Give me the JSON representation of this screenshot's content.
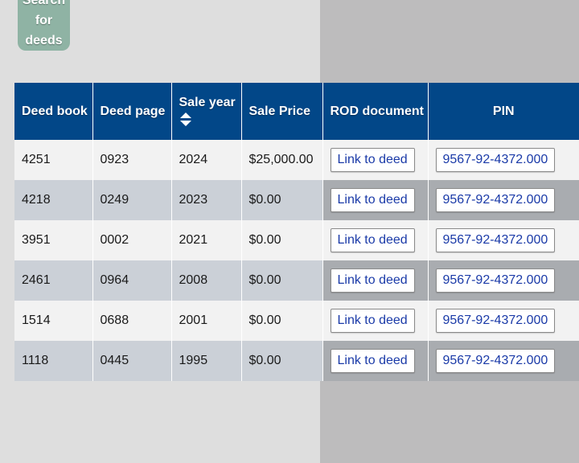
{
  "search_button": {
    "lines": [
      "Search",
      "for",
      "deeds"
    ]
  },
  "table": {
    "headers": {
      "deed_book": "Deed book",
      "deed_page": "Deed page",
      "sale_year": "Sale year",
      "sale_price": "Sale Price",
      "rod_document": "ROD document",
      "pin": "PIN"
    },
    "rows": [
      {
        "deed_book": "4251",
        "deed_page": "0923",
        "sale_year": "2024",
        "sale_price": "$25,000.00",
        "rod_link": "Link to deed",
        "pin": "9567-92-4372.000"
      },
      {
        "deed_book": "4218",
        "deed_page": "0249",
        "sale_year": "2023",
        "sale_price": "$0.00",
        "rod_link": "Link to deed",
        "pin": "9567-92-4372.000"
      },
      {
        "deed_book": "3951",
        "deed_page": "0002",
        "sale_year": "2021",
        "sale_price": "$0.00",
        "rod_link": "Link to deed",
        "pin": "9567-92-4372.000"
      },
      {
        "deed_book": "2461",
        "deed_page": "0964",
        "sale_year": "2008",
        "sale_price": "$0.00",
        "rod_link": "Link to deed",
        "pin": "9567-92-4372.000"
      },
      {
        "deed_book": "1514",
        "deed_page": "0688",
        "sale_year": "2001",
        "sale_price": "$0.00",
        "rod_link": "Link to deed",
        "pin": "9567-92-4372.000"
      },
      {
        "deed_book": "1118",
        "deed_page": "0445",
        "sale_year": "1995",
        "sale_price": "$0.00",
        "rod_link": "Link to deed",
        "pin": "9567-92-4372.000"
      }
    ]
  },
  "colors": {
    "header_bg": "#024788",
    "search_button_bg": "#8fb3a4",
    "link_text": "#1a3aa8"
  },
  "icons": {
    "sort": "sort-arrows-icon"
  }
}
